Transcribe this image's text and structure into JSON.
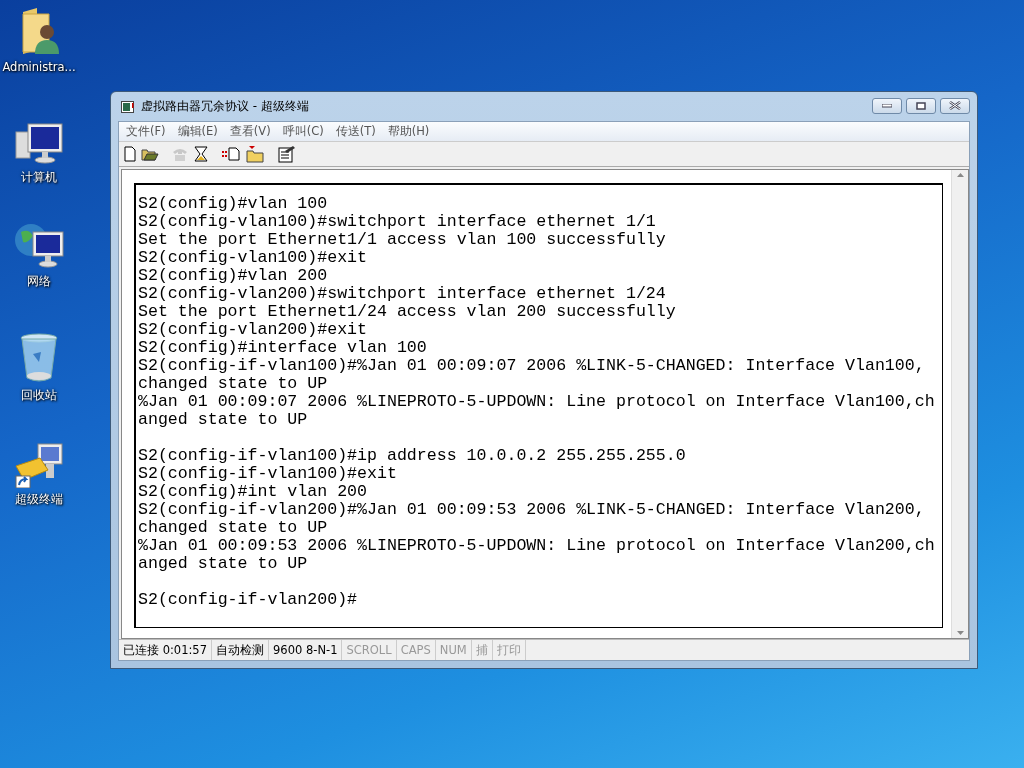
{
  "desktop_icons": [
    {
      "label": "Administra..."
    },
    {
      "label": "计算机"
    },
    {
      "label": "网络"
    },
    {
      "label": "回收站"
    },
    {
      "label": "超级终端"
    }
  ],
  "window": {
    "title": "虚拟路由器冗余协议 - 超级终端"
  },
  "menu": [
    "文件(F)",
    "编辑(E)",
    "查看(V)",
    "呼叫(C)",
    "传送(T)",
    "帮助(H)"
  ],
  "toolbar": [
    {
      "disabled": false
    },
    {
      "disabled": false
    },
    {
      "disabled": true
    },
    {
      "disabled": false
    },
    {
      "disabled": false
    },
    {
      "disabled": false
    },
    {
      "disabled": false
    }
  ],
  "terminal": {
    "output": "S2(config)#vlan 100\nS2(config-vlan100)#switchport interface ethernet 1/1\nSet the port Ethernet1/1 access vlan 100 successfully\nS2(config-vlan100)#exit\nS2(config)#vlan 200\nS2(config-vlan200)#switchport interface ethernet 1/24\nSet the port Ethernet1/24 access vlan 200 successfully\nS2(config-vlan200)#exit\nS2(config)#interface vlan 100\nS2(config-if-vlan100)#%Jan 01 00:09:07 2006 %LINK-5-CHANGED: Interface Vlan100,\nchanged state to UP\n%Jan 01 00:09:07 2006 %LINEPROTO-5-UPDOWN: Line protocol on Interface Vlan100,ch\nanged state to UP\n\nS2(config-if-vlan100)#ip address 10.0.0.2 255.255.255.0\nS2(config-if-vlan100)#exit\nS2(config)#int vlan 200\nS2(config-if-vlan200)#%Jan 01 00:09:53 2006 %LINK-5-CHANGED: Interface Vlan200,\nchanged state to UP\n%Jan 01 00:09:53 2006 %LINEPROTO-5-UPDOWN: Line protocol on Interface Vlan200,ch\nanged state to UP\n\nS2(config-if-vlan200)#"
  },
  "status_bar": [
    {
      "text": "已连接 0:01:57",
      "disabled": false
    },
    {
      "text": "自动检测",
      "disabled": false
    },
    {
      "text": "9600 8-N-1",
      "disabled": false
    },
    {
      "text": "SCROLL",
      "disabled": true
    },
    {
      "text": "CAPS",
      "disabled": true
    },
    {
      "text": "NUM",
      "disabled": true
    },
    {
      "text": "捕",
      "disabled": true
    },
    {
      "text": "打印",
      "disabled": true
    }
  ]
}
